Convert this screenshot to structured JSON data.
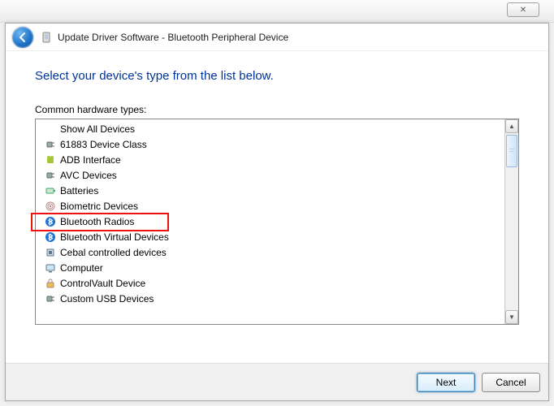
{
  "window": {
    "title": "Update Driver Software - Bluetooth Peripheral Device"
  },
  "body": {
    "instruction": "Select your device's type from the list below.",
    "list_label": "Common hardware types:"
  },
  "list": {
    "items": [
      {
        "label": "Show All Devices",
        "icon": "none"
      },
      {
        "label": "61883 Device Class",
        "icon": "plug"
      },
      {
        "label": "ADB Interface",
        "icon": "android"
      },
      {
        "label": "AVC Devices",
        "icon": "plug"
      },
      {
        "label": "Batteries",
        "icon": "battery"
      },
      {
        "label": "Biometric Devices",
        "icon": "fingerprint"
      },
      {
        "label": "Bluetooth Radios",
        "icon": "bluetooth",
        "highlighted": true
      },
      {
        "label": "Bluetooth Virtual Devices",
        "icon": "bluetooth"
      },
      {
        "label": "Cebal controlled devices",
        "icon": "chip"
      },
      {
        "label": "Computer",
        "icon": "computer"
      },
      {
        "label": "ControlVault Device",
        "icon": "lock"
      },
      {
        "label": "Custom USB Devices",
        "icon": "plug"
      }
    ]
  },
  "footer": {
    "next": "Next",
    "cancel": "Cancel"
  }
}
